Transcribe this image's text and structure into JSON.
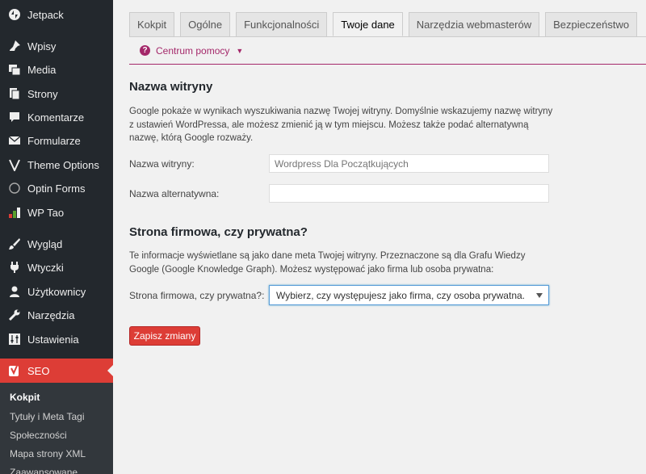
{
  "sidebar": {
    "items": [
      {
        "label": "Jetpack",
        "icon": "jetpack-icon"
      },
      {
        "label": "Wpisy",
        "icon": "pin-icon"
      },
      {
        "label": "Media",
        "icon": "media-icon"
      },
      {
        "label": "Strony",
        "icon": "pages-icon"
      },
      {
        "label": "Komentarze",
        "icon": "comment-icon"
      },
      {
        "label": "Formularze",
        "icon": "mail-icon"
      },
      {
        "label": "Theme Options",
        "icon": "v-icon"
      },
      {
        "label": "Optin Forms",
        "icon": "circle-icon"
      },
      {
        "label": "WP Tao",
        "icon": "bar-chart-icon"
      },
      {
        "label": "Wygląd",
        "icon": "brush-icon"
      },
      {
        "label": "Wtyczki",
        "icon": "plugin-icon"
      },
      {
        "label": "Użytkownicy",
        "icon": "user-icon"
      },
      {
        "label": "Narzędzia",
        "icon": "wrench-icon"
      },
      {
        "label": "Ustawienia",
        "icon": "settings-icon"
      },
      {
        "label": "SEO",
        "icon": "yoast-icon"
      }
    ],
    "submenu": [
      "Kokpit",
      "Tytuły i Meta Tagi",
      "Społeczności",
      "Mapa strony XML",
      "Zaawansowane"
    ]
  },
  "tabs": [
    "Kokpit",
    "Ogólne",
    "Funkcjonalności",
    "Twoje dane",
    "Narzędzia webmasterów",
    "Bezpieczeństwo"
  ],
  "help": {
    "label": "Centrum pomocy"
  },
  "site_section": {
    "title": "Nazwa witryny",
    "description": "Google pokaże w wynikach wyszukiwania nazwę Twojej witryny. Domyślnie wskazujemy nazwę witryny z ustawień WordPressa, ale możesz zmienić ją w tym miejscu. Możesz także podać alternatywną nazwę, którą Google rozważy.",
    "name_label": "Nazwa witryny:",
    "name_value": "Wordpress Dla Początkujących",
    "alt_label": "Nazwa alternatywna:",
    "alt_value": ""
  },
  "company_section": {
    "title": "Strona firmowa, czy prywatna?",
    "description": "Te informacje wyświetlane są jako dane meta Twojej witryny. Przeznaczone są dla Grafu Wiedzy Google (Google Knowledge Graph). Możesz występować jako firma lub osoba prywatna:",
    "select_label": "Strona firmowa, czy prywatna?:",
    "select_value": "Wybierz, czy występujesz jako firma, czy osoba prywatna."
  },
  "save_label": "Zapisz zmiany",
  "colors": {
    "sidebar": "#23282d",
    "active": "#dd3d36",
    "accent": "#a4286a"
  }
}
